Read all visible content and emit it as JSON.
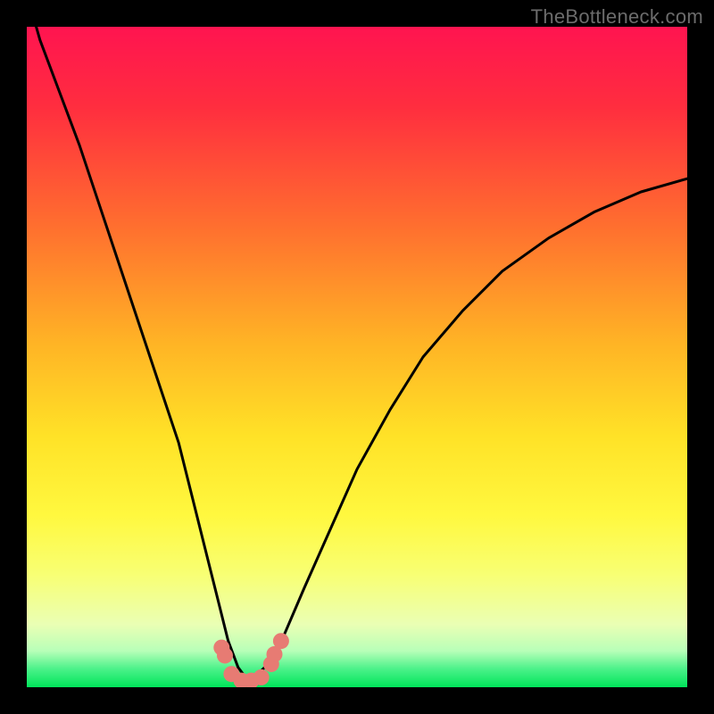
{
  "watermark": "TheBottleneck.com",
  "chart_data": {
    "type": "line",
    "title": "",
    "xlabel": "",
    "ylabel": "",
    "xlim": [
      0,
      100
    ],
    "ylim": [
      0,
      100
    ],
    "grid": false,
    "legend": false,
    "gradient_stops": [
      {
        "pos": 0.0,
        "color": "#ff1450"
      },
      {
        "pos": 0.12,
        "color": "#ff2d3f"
      },
      {
        "pos": 0.3,
        "color": "#ff6e2f"
      },
      {
        "pos": 0.48,
        "color": "#ffb425"
      },
      {
        "pos": 0.62,
        "color": "#ffe227"
      },
      {
        "pos": 0.74,
        "color": "#fff83f"
      },
      {
        "pos": 0.83,
        "color": "#f8ff74"
      },
      {
        "pos": 0.905,
        "color": "#eaffb4"
      },
      {
        "pos": 0.945,
        "color": "#b8ffb8"
      },
      {
        "pos": 0.972,
        "color": "#4cf28a"
      },
      {
        "pos": 1.0,
        "color": "#00e45a"
      }
    ],
    "series": [
      {
        "name": "bottleneck-curve",
        "color": "#000000",
        "width": 3,
        "x": [
          0,
          2,
          5,
          8,
          11,
          14,
          17,
          20,
          23,
          25,
          27,
          29,
          30.5,
          32,
          33.5,
          35,
          37,
          39,
          42,
          46,
          50,
          55,
          60,
          66,
          72,
          79,
          86,
          93,
          100
        ],
        "y": [
          105,
          98,
          90,
          82,
          73,
          64,
          55,
          46,
          37,
          29,
          21,
          13,
          7,
          3,
          1,
          2,
          4,
          8,
          15,
          24,
          33,
          42,
          50,
          57,
          63,
          68,
          72,
          75,
          77
        ]
      },
      {
        "name": "trough-markers",
        "type": "scatter",
        "color": "#e77b73",
        "radius": 9,
        "x": [
          29.5,
          30.0,
          31.0,
          32.5,
          34.0,
          35.5,
          37.0,
          37.5,
          38.5
        ],
        "y": [
          6.0,
          4.8,
          2.0,
          1.0,
          1.0,
          1.5,
          3.5,
          5.0,
          7.0
        ]
      }
    ]
  }
}
